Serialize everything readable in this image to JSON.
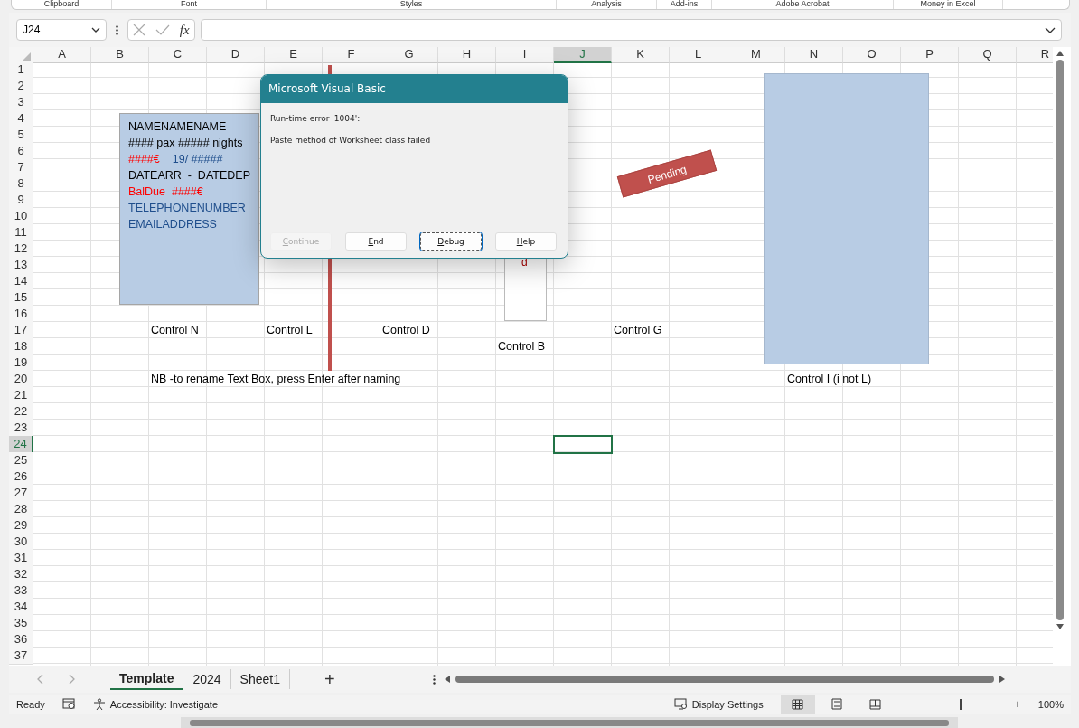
{
  "ribbon_groups": [
    "Clipboard",
    "Font",
    "Styles",
    "Analysis",
    "Add-ins",
    "Adobe Acrobat",
    "Money in Excel"
  ],
  "name_box": {
    "value": "J24"
  },
  "formula_bar": {
    "function_label": "fx"
  },
  "columns": [
    {
      "label": "A",
      "selected": false
    },
    {
      "label": "B",
      "selected": false
    },
    {
      "label": "C",
      "selected": false
    },
    {
      "label": "D",
      "selected": false
    },
    {
      "label": "E",
      "selected": false
    },
    {
      "label": "F",
      "selected": false
    },
    {
      "label": "G",
      "selected": false
    },
    {
      "label": "H",
      "selected": false
    },
    {
      "label": "I",
      "selected": false
    },
    {
      "label": "J",
      "selected": true
    },
    {
      "label": "K",
      "selected": false
    },
    {
      "label": "L",
      "selected": false
    },
    {
      "label": "M",
      "selected": false
    },
    {
      "label": "N",
      "selected": false
    },
    {
      "label": "O",
      "selected": false
    },
    {
      "label": "P",
      "selected": false
    },
    {
      "label": "Q",
      "selected": false
    },
    {
      "label": "R",
      "selected": false
    }
  ],
  "rows": [
    {
      "label": "1",
      "selected": false
    },
    {
      "label": "2",
      "selected": false
    },
    {
      "label": "3",
      "selected": false
    },
    {
      "label": "4",
      "selected": false
    },
    {
      "label": "5",
      "selected": false
    },
    {
      "label": "6",
      "selected": false
    },
    {
      "label": "7",
      "selected": false
    },
    {
      "label": "8",
      "selected": false
    },
    {
      "label": "9",
      "selected": false
    },
    {
      "label": "10",
      "selected": false
    },
    {
      "label": "11",
      "selected": false
    },
    {
      "label": "12",
      "selected": false
    },
    {
      "label": "13",
      "selected": false
    },
    {
      "label": "14",
      "selected": false
    },
    {
      "label": "15",
      "selected": false
    },
    {
      "label": "16",
      "selected": false
    },
    {
      "label": "17",
      "selected": false,
      "cells": {
        "C": "Control N",
        "E": "Control L",
        "G": "Control D",
        "K": "Control G"
      }
    },
    {
      "label": "18",
      "selected": false,
      "cells": {
        "I": "Control B"
      }
    },
    {
      "label": "19",
      "selected": false
    },
    {
      "label": "20",
      "selected": false,
      "cells": {
        "C": "NB -to rename Text Box, press Enter after naming",
        "N": "Control I (i not L)"
      }
    },
    {
      "label": "21",
      "selected": false
    },
    {
      "label": "22",
      "selected": false
    },
    {
      "label": "23",
      "selected": false
    },
    {
      "label": "24",
      "selected": true
    },
    {
      "label": "25",
      "selected": false
    },
    {
      "label": "26",
      "selected": false
    },
    {
      "label": "27",
      "selected": false
    },
    {
      "label": "28",
      "selected": false
    },
    {
      "label": "29",
      "selected": false
    },
    {
      "label": "30",
      "selected": false
    },
    {
      "label": "31",
      "selected": false
    },
    {
      "label": "32",
      "selected": false
    },
    {
      "label": "33",
      "selected": false
    },
    {
      "label": "34",
      "selected": false
    },
    {
      "label": "35",
      "selected": false
    },
    {
      "label": "36",
      "selected": false
    },
    {
      "label": "37",
      "selected": false
    }
  ],
  "text_box": {
    "lines": [
      [
        {
          "text": "NAMENAMENAME"
        }
      ],
      [
        {
          "text": "#### pax ##### nights"
        }
      ],
      [
        {
          "text": "####€",
          "color": "#ff0000"
        },
        {
          "text": "19/ #####",
          "color": "#1f4e8c"
        }
      ],
      [
        {
          "text": "DATEARR  -  DATEDEP"
        }
      ],
      [
        {
          "text": "BalDue  ####€",
          "color": "#ff0000"
        }
      ],
      [
        {
          "text": "TELEPHONENUMBER",
          "color": "#1f4e8c"
        }
      ],
      [
        {
          "text": "EMAILADDRESS",
          "color": "#1f4e8c"
        }
      ]
    ]
  },
  "narrow_shape": {
    "text": "d"
  },
  "status_tag": {
    "text": "Pending"
  },
  "dialog": {
    "title": "Microsoft Visual Basic",
    "error": "Run-time error '1004':",
    "message": "Paste method of Worksheet class failed",
    "buttons": [
      {
        "label": "Continue",
        "disabled": true,
        "focused": false
      },
      {
        "label": "End",
        "disabled": false,
        "focused": false
      },
      {
        "label": "Debug",
        "disabled": false,
        "focused": true
      },
      {
        "label": "Help",
        "disabled": false,
        "focused": false
      }
    ]
  },
  "sheet_tabs": [
    {
      "label": "Template",
      "selected": true
    },
    {
      "label": "2024",
      "selected": false
    },
    {
      "label": "Sheet1",
      "selected": false
    }
  ],
  "add_sheet": "+",
  "status_bar": {
    "ready": "Ready",
    "accessibility": "Accessibility: Investigate",
    "display_settings": "Display Settings",
    "views": [
      {
        "kind": "normal",
        "selected": true
      },
      {
        "kind": "page_layout",
        "selected": false
      },
      {
        "kind": "page_break",
        "selected": false
      }
    ],
    "zoom_minus": "−",
    "zoom_plus": "+",
    "zoom": {
      "level": 0.5
    },
    "zoom_reading": "100%"
  }
}
